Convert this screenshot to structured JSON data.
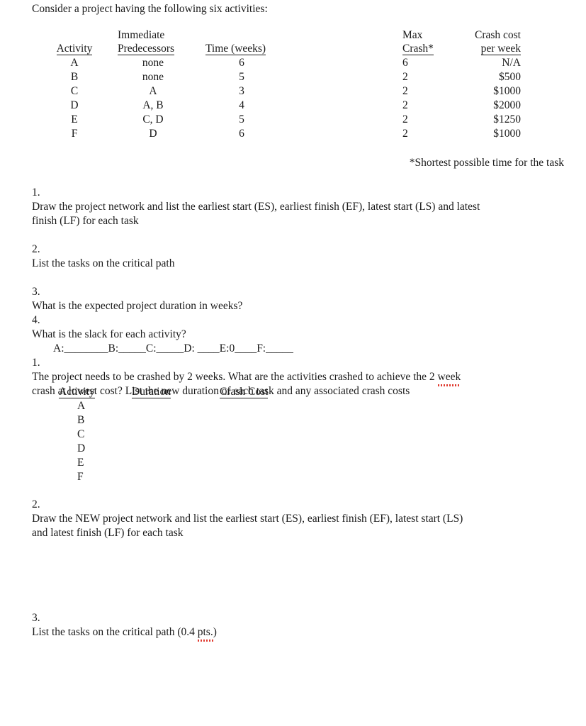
{
  "document": {
    "intro": "Consider a project having the following six activities:",
    "footnote": "*Shortest possible time for the task"
  },
  "activity_table": {
    "headers": {
      "activity": "Activity",
      "immediate": "Immediate",
      "predecessors": "Predecessors",
      "time": "Time (weeks)",
      "max": "Max",
      "crash": "Crash*",
      "crash_cost": "Crash cost",
      "per_week": "per week"
    },
    "rows": [
      {
        "activity": "A",
        "predecessors": "none",
        "time": "6",
        "max_crash": "6",
        "crash_cost": "N/A"
      },
      {
        "activity": "B",
        "predecessors": "none",
        "time": "5",
        "max_crash": "2",
        "crash_cost": "$500"
      },
      {
        "activity": "C",
        "predecessors": "A",
        "time": "3",
        "max_crash": "2",
        "crash_cost": "$1000"
      },
      {
        "activity": "D",
        "predecessors": "A, B",
        "time": "4",
        "max_crash": "2",
        "crash_cost": "$2000"
      },
      {
        "activity": "E",
        "predecessors": "C, D",
        "time": "5",
        "max_crash": "2",
        "crash_cost": "$1250"
      },
      {
        "activity": "F",
        "predecessors": "D",
        "time": "6",
        "max_crash": "2",
        "crash_cost": "$1000"
      }
    ]
  },
  "questions": {
    "q1": {
      "num": "1.",
      "line1": "Draw the project network and list the earliest start (ES), earliest finish (EF), latest start (LS) and latest",
      "line2": "finish (LF) for each task"
    },
    "q2": {
      "num": "2.",
      "line1": "List the tasks on the critical path"
    },
    "q3": {
      "num": "3.",
      "line1": "What is the expected project duration in weeks?"
    },
    "q4": {
      "num": "4.",
      "line1": "What is the slack for each activity?",
      "answer_line": "A:________B:_____C:_____D: ____E:0____F:_____"
    },
    "q5": {
      "num": "1.",
      "line1_a": "The project needs to be crashed by 2 weeks.  What are the activities crashed to achieve the 2 ",
      "line1_b": "week",
      "line2": "crash at lowest cost?  List the new duration of each task and any associated crash costs"
    },
    "q6": {
      "num": "2.",
      "line1": "Draw the NEW project network and list the earliest start (ES), earliest finish (EF), latest start (LS)",
      "line2": "and latest finish (LF) for each task"
    },
    "q7": {
      "num": "3.",
      "line1_a": "List the tasks on the critical path (0.4 ",
      "line1_b": "pts.",
      "line1_c": ")"
    }
  },
  "crash_table": {
    "headers": {
      "activity": "Activity",
      "duration": "Duration",
      "crash_cost": "Crash Cost"
    },
    "rows": [
      {
        "activity": "A",
        "duration": "",
        "crash_cost": ""
      },
      {
        "activity": "B",
        "duration": "",
        "crash_cost": ""
      },
      {
        "activity": "C",
        "duration": "",
        "crash_cost": ""
      },
      {
        "activity": "D",
        "duration": "",
        "crash_cost": ""
      },
      {
        "activity": "E",
        "duration": "",
        "crash_cost": ""
      },
      {
        "activity": "F",
        "duration": "",
        "crash_cost": ""
      }
    ]
  },
  "colors": {
    "text": "#1a1a1a",
    "background": "#ffffff",
    "spellcheck": "#e03a2f"
  }
}
